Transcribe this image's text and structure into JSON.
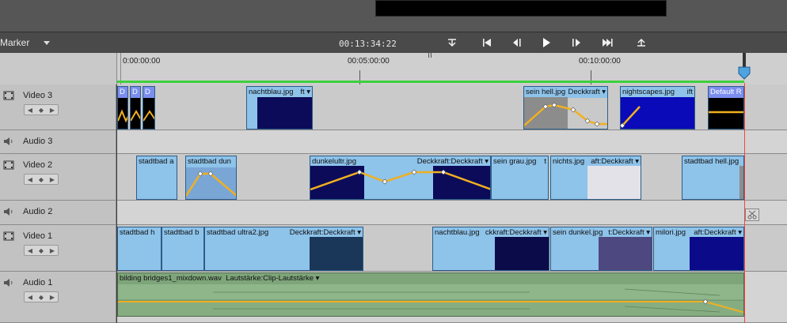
{
  "toolbar": {
    "marker_label": "Marker",
    "timecode": "00:13:34:22",
    "buttons": [
      "go-to-start",
      "previous-edit",
      "step-back",
      "play",
      "step-forward",
      "next-edit",
      "go-to-end"
    ]
  },
  "ruler": {
    "labels": [
      "0:00:00:00",
      "00:05:00:00",
      "00:10:00:00"
    ]
  },
  "tracks": [
    {
      "name": "Video 3",
      "type": "video"
    },
    {
      "name": "Audio 3",
      "type": "audio"
    },
    {
      "name": "Video 2",
      "type": "video"
    },
    {
      "name": "Audio 2",
      "type": "audio"
    },
    {
      "name": "Video 1",
      "type": "video"
    },
    {
      "name": "Audio 1",
      "type": "audio"
    }
  ],
  "clips": {
    "v3": [
      {
        "label": "D"
      },
      {
        "label": "D"
      },
      {
        "label": "D"
      },
      {
        "label": "nachtblau.jpg",
        "right": "ft ▾"
      },
      {
        "label": "sein hell.jpg",
        "right": "Deckkraft ▾"
      },
      {
        "label": "nightscapes.jpg",
        "right": "ift"
      },
      {
        "label": "Default R"
      }
    ],
    "v2": [
      {
        "label": "stadtbad a"
      },
      {
        "label": "stadtbad dun"
      },
      {
        "label": "dunkelultr.jpg",
        "right": "Deckkraft:Deckkraft ▾"
      },
      {
        "label": "sein grau.jpg",
        "right": "t"
      },
      {
        "label": "nichts.jpg",
        "right": "aft:Deckkraft ▾"
      },
      {
        "label": "stadtbad hell.jpg"
      }
    ],
    "v1": [
      {
        "label": "stadtbad h"
      },
      {
        "label": "stadtbad b"
      },
      {
        "label": "stadtbad ultra2.jpg",
        "right": "Deckkraft:Deckkraft ▾"
      },
      {
        "label": "nachtblau.jpg",
        "right": "ckkraft:Deckkraft ▾"
      },
      {
        "label": "sein dunkel.jpg",
        "right": "t:Deckkraft ▾"
      },
      {
        "label": "milori.jpg",
        "right": "aft:Deckkraft ▾"
      }
    ],
    "a1": [
      {
        "label": "bilding bridges1_mixdown.wav",
        "right": "Lautstärke:Clip-Lautstärke ▾"
      }
    ]
  },
  "colors": {
    "clip": "#8ec3ea",
    "clip_dark": "#0b0b5a",
    "keyframe_line": "#f0b020",
    "playhead": "#e44444",
    "render_bar": "#3cd03c",
    "audio_clip": "#7ea57a"
  }
}
